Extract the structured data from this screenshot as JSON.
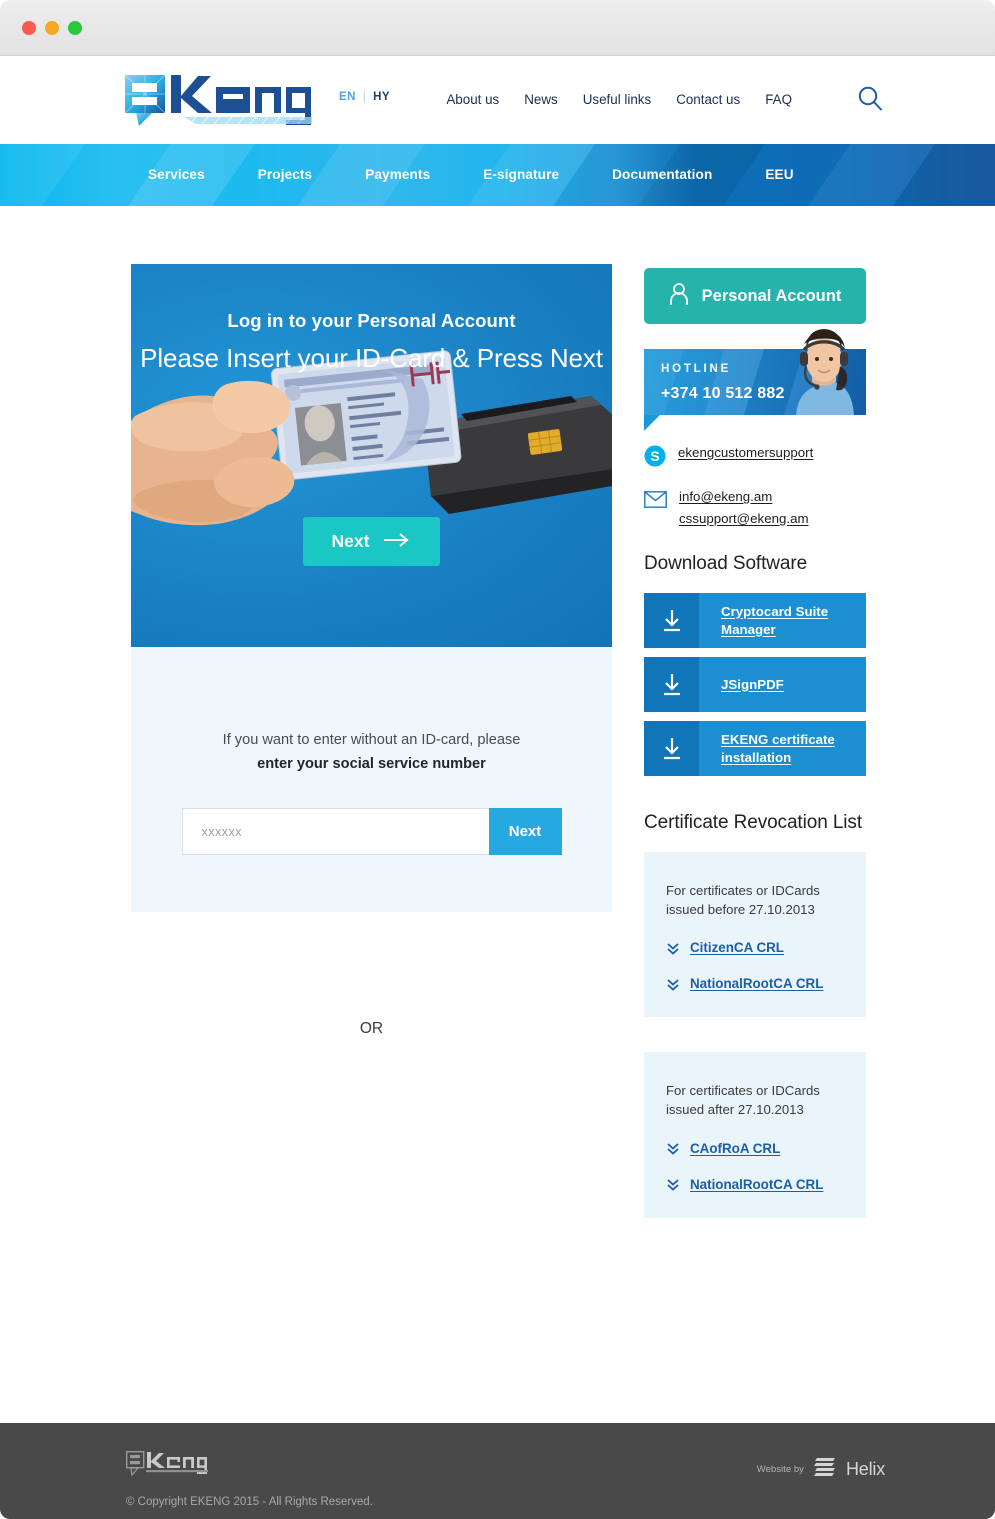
{
  "window": {
    "traffic_lights": [
      "close",
      "minimize",
      "maximize"
    ]
  },
  "header": {
    "logo_text": "ekeng",
    "lang": {
      "active": "EN",
      "separator": "|",
      "other": "HY"
    },
    "nav": [
      {
        "label": "About us"
      },
      {
        "label": "News"
      },
      {
        "label": "Useful links"
      },
      {
        "label": "Contact us"
      },
      {
        "label": "FAQ"
      }
    ],
    "search_icon": "search-icon"
  },
  "mainnav": {
    "items": [
      {
        "label": "Services"
      },
      {
        "label": "Projects"
      },
      {
        "label": "Payments"
      },
      {
        "label": "E-signature"
      },
      {
        "label": "Documentation"
      },
      {
        "label": "EEU"
      }
    ]
  },
  "login": {
    "subtitle": "Log in to your Personal Account",
    "title": "Please Insert your ID-Card & Press Next",
    "next_label": "Next",
    "or_label": "OR",
    "alt_line1": "If you want to enter without an ID-card, please",
    "alt_line2": "enter your social service number",
    "ssn_placeholder": "xxxxxx",
    "ssn_value": "",
    "ssn_next_label": "Next"
  },
  "sidebar": {
    "personal_account_label": "Personal Account",
    "hotline": {
      "label": "HOTLINE",
      "phone": "+374 10 512 882"
    },
    "contacts": {
      "skype": "ekengcustomersupport",
      "emails": [
        "info@ekeng.am",
        "cssupport@ekeng.am"
      ]
    },
    "download": {
      "title": "Download Software",
      "items": [
        {
          "label": "Cryptocard Suite Manager"
        },
        {
          "label": "JSignPDF"
        },
        {
          "label": "EKENG certificate installation"
        }
      ]
    },
    "crl": {
      "title": "Certificate Revocation List",
      "blocks": [
        {
          "note": "For certificates or IDCards issued before 27.10.2013",
          "links": [
            {
              "label": "CitizenCA CRL"
            },
            {
              "label": "NationalRootCA CRL"
            }
          ]
        },
        {
          "note": "For certificates or IDCards issued after 27.10.2013",
          "links": [
            {
              "label": "CAofRoA CRL"
            },
            {
              "label": "NationalRootCA CRL"
            }
          ]
        }
      ]
    }
  },
  "footer": {
    "logo_text": "ekeng",
    "copyright": "© Copyright EKENG 2015 - All Rights Reserved.",
    "website_by": "Website by",
    "agency": "Helix"
  },
  "colors": {
    "accent_blue": "#26a9e0",
    "deep_blue": "#1176b9",
    "teal": "#25b3ab",
    "next_teal": "#1bc7c4",
    "navy_text": "#1b2d4f",
    "panel_bg": "#eaf4fb",
    "footer_bg": "#494949"
  }
}
